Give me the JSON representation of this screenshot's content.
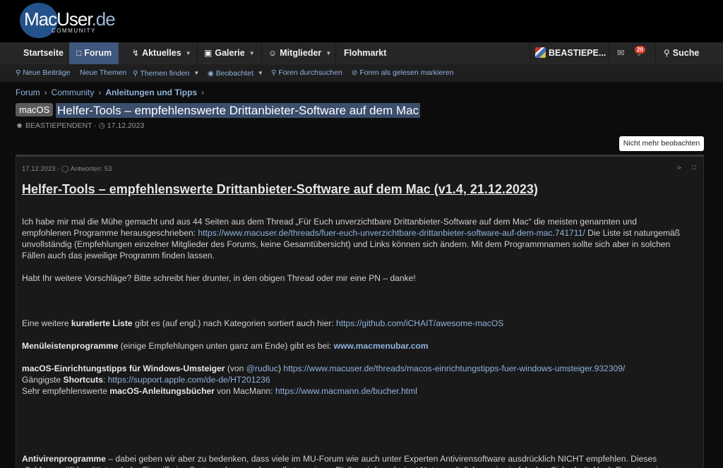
{
  "logo": {
    "main": "MacUser",
    "suffix": ".de",
    "sub": "COMMUNITY"
  },
  "nav": {
    "items": [
      {
        "label": "Startseite"
      },
      {
        "label": "Forum",
        "icon": "chat-icon"
      },
      {
        "label": "Aktuelles",
        "icon": "bolt-icon"
      },
      {
        "label": "Galerie",
        "icon": "camera-icon"
      },
      {
        "label": "Mitglieder",
        "icon": "users-icon"
      },
      {
        "label": "Flohmarkt"
      }
    ],
    "user": "BEASTIEPE...",
    "alert_count": "20",
    "search": "Suche"
  },
  "subnav": [
    {
      "label": "Neue Beiträge",
      "icon": "search-icon"
    },
    {
      "label": "Neue Themen"
    },
    {
      "label": "Themen finden",
      "icon": "search-icon"
    },
    {
      "label": "Beobachtet",
      "icon": "eye-icon"
    },
    {
      "label": "Foren durchsuchen",
      "icon": "search-icon"
    },
    {
      "label": "Foren als gelesen markieren",
      "icon": "eye-off-icon"
    }
  ],
  "breadcrumb": [
    "Forum",
    "Community",
    "Anleitungen und Tipps"
  ],
  "thread": {
    "prefix": "macOS",
    "title": "Helfer-Tools – empfehlenswerte Drittanbieter-Software auf dem Mac",
    "author": "BEASTIEPENDENT",
    "date": "17.12.2023",
    "watch_button": "Nicht mehr beobachten"
  },
  "post": {
    "date": "17.12.2023",
    "replies": "Antworten: 53",
    "title": "Helfer-Tools – empfehlenswerte Drittanbieter-Software auf dem Mac (v1.4, 21.12.2023)",
    "p1a": "Ich habe mir mal die Mühe gemacht und aus 44 Seiten aus dem Thread „Für Euch unverzichtbare Drittanbieter-Software auf dem Mac“ die meisten genannten und empfohlenen Programme herausgeschrieben: ",
    "p1_link": "https://www.macuser.de/threads/fuer-euch-unverzichtbare-drittanbieter-software-auf-dem-mac.741711/",
    "p1b": " Die Liste ist naturgemäß unvollständig (Empfehlungen einzelner Mitglieder des Forums, keine Gesamtübersicht) und Links können sich ändern. Mit dem Programmnamen sollte sich aber in solchen Fällen auch das jeweilige Programm finden lassen.",
    "p2": "Habt Ihr weitere Vorschläge? Bitte schreibt hier drunter, in den obigen Thread oder mir eine PN – danke!",
    "p3a": "Eine weitere ",
    "p3_bold": "kuratierte Liste",
    "p3b": " gibt es (auf engl.) nach Kategorien sortiert auch hier: ",
    "p3_link": "https://github.com/iCHAIT/awesome-macOS",
    "p4_bold": "Menüleistenprogramme",
    "p4a": " (einige Empfehlungen unten ganz am Ende) gibt es bei: ",
    "p4_link": "www.macmenubar.com",
    "p5_bold": "macOS-Einrichtungstipps für Windows-Umsteiger",
    "p5a": " (von ",
    "p5_user": "@rudluc",
    "p5b": ") ",
    "p5_link": "https://www.macuser.de/threads/macos-einrichtungstipps-fuer-windows-umsteiger.932309/",
    "p6a": "Gängigste ",
    "p6_bold": "Shortcuts",
    "p6b": ": ",
    "p6_link": "https://support.apple.com/de-de/HT201236",
    "p7a": "Sehr empfehlenswerte ",
    "p7_bold": "macOS-Anleitungsbücher",
    "p7b": " von MacMann: ",
    "p7_link": "https://www.macmann.de/bucher.html",
    "p8_bold": "Antivirenprogramme",
    "p8": " – dabei geben wir aber zu bedenken, dass viele im MU-Forum wie auch unter Experten Antivirensoftware ausdrücklich NICHT empfehlen. Dieses „Schlangenöl“ benötigt so hohe Eingriffe ins System, dass es eher selbst zu einem Risiko wird, und wiegt Nutzer möglicherweise in falscher Sicherheit. Nach Expertenwissen sind regelmäßige"
  }
}
